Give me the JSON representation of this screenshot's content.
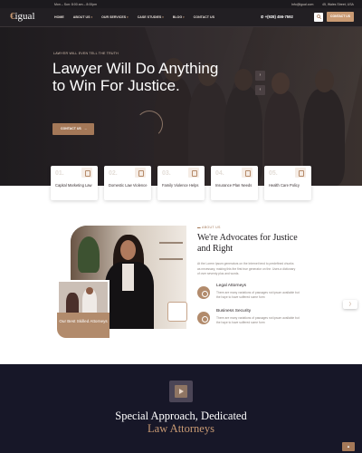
{
  "topbar": {
    "hours": "Mon – Sun: 8:00 am – 8:00pm",
    "email": "Info@igual.com",
    "address": "45, Wales Street, USA"
  },
  "header": {
    "logo_mark": "€",
    "logo_text": "igual",
    "nav": [
      {
        "label": "HOME",
        "has_dropdown": false
      },
      {
        "label": "ABOUT US",
        "has_dropdown": true
      },
      {
        "label": "OUR SERVICES",
        "has_dropdown": true
      },
      {
        "label": "CASE STUDIES",
        "has_dropdown": true
      },
      {
        "label": "BLOG",
        "has_dropdown": true
      },
      {
        "label": "CONTACT US",
        "has_dropdown": false
      }
    ],
    "phone": "+(928) 456-7592",
    "cta": "CONTACT US"
  },
  "hero": {
    "eyebrow": "LAWYER WILL EVEN TELL THE TRUTH",
    "title": "Lawyer Will Do Anything to Win For Justice.",
    "button": "CONTACT US",
    "button_arrow": "→",
    "prev_arrow": "›",
    "next_arrow": "‹"
  },
  "services": [
    {
      "num": "01.",
      "label": "Capital Marketing Law"
    },
    {
      "num": "02.",
      "label": "Domestic Law Violence"
    },
    {
      "num": "03.",
      "label": "Family Violence Helps"
    },
    {
      "num": "04.",
      "label": "Insurance Plan Needs"
    },
    {
      "num": "05.",
      "label": "Health Care Policy"
    }
  ],
  "about": {
    "eyebrow": "ABOUT US",
    "title": "We're Advocates for Justice and Right",
    "paragraph": "At the Lorem Ipsum generators on the Internet tend to predefined chunks as necessary, making this the first true generator on the. Uses a dictionary of over seventy plus and words.",
    "badge": "Our Best Skilled Attorneys",
    "features": [
      {
        "title": "Legal Attorneys",
        "desc": "There are many variations of passages not ipsum available but the haye to have suffered some form"
      },
      {
        "title": "Business Security",
        "desc": "There are many variations of passages not ipsum available but the haye to have suffered some form"
      }
    ],
    "side_tab_icon": "⟩"
  },
  "special": {
    "title_line1": "Special Approach, Dedicated",
    "title_line2": "Law Attorneys",
    "to_top": "▲"
  },
  "colors": {
    "accent": "#c99a73",
    "dark_header": "#221f23",
    "dark_section": "#171728"
  }
}
